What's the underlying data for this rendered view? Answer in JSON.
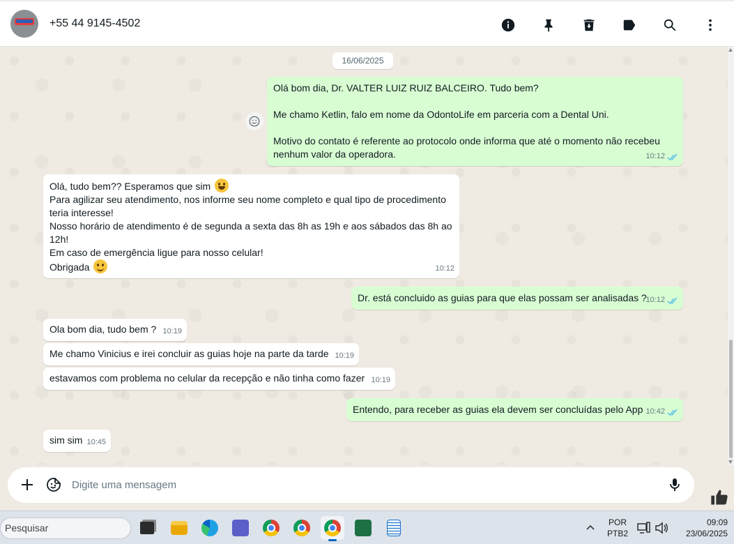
{
  "header": {
    "contact_name": "+55 44 9145-4502",
    "icons": [
      "info-icon",
      "pin-icon",
      "delete-icon",
      "label-icon",
      "search-icon",
      "menu-icon"
    ]
  },
  "chat": {
    "date_chip": "16/06/2025",
    "messages": [
      {
        "direction": "out",
        "text": "Olá bom dia, Dr. VALTER LUIZ RUIZ BALCEIRO. Tudo bem?\n\nMe chamo Ketlin, falo em nome da OdontoLife em parceria com a Dental Uni.\n\nMotivo do contato é referente ao protocolo onde informa que até o momento não recebeu nenhum valor da operadora.",
        "time": "10:12",
        "read": true
      },
      {
        "direction": "in",
        "line1": "Olá, tudo bem?? Esperamos que sim ",
        "body": "Para agilizar seu atendimento, nos informe seu nome completo e qual tipo de procedimento teria interesse!\nNosso horário de atendimento é de segunda a sexta das 8h as 19h e aos sábados das 8h ao 12h!\nEm caso de emergência ligue para nosso celular!",
        "last_line": "Obrigada ",
        "time": "10:12"
      },
      {
        "direction": "out",
        "text": "Dr. está concluido as guias para que elas possam ser analisadas ?",
        "time": "10:12",
        "read": true
      },
      {
        "direction": "in",
        "text": "Ola bom dia, tudo bem ?",
        "time": "10:19"
      },
      {
        "direction": "in",
        "text": "Me chamo Vinicius e irei concluir as guias hoje na parte da tarde",
        "time": "10:19"
      },
      {
        "direction": "in",
        "text": "estavamos com problema no celular da recepção e não tinha como fazer",
        "time": "10:19"
      },
      {
        "direction": "out",
        "text": "Entendo, para receber as guias ela devem ser concluídas pelo App",
        "time": "10:42",
        "read": true
      },
      {
        "direction": "in",
        "text": "sim sim",
        "time": "10:45"
      }
    ]
  },
  "composer": {
    "placeholder": "Digite uma mensagem"
  },
  "taskbar": {
    "search_placeholder": "Pesquisar",
    "lang_top": "POR",
    "lang_bottom": "PTB2",
    "time": "09:09",
    "date": "23/06/2025"
  },
  "colors": {
    "outgoing_bubble": "#d9fdd3",
    "incoming_bubble": "#ffffff",
    "chat_background": "#efeae2",
    "read_ticks": "#53bdeb"
  }
}
